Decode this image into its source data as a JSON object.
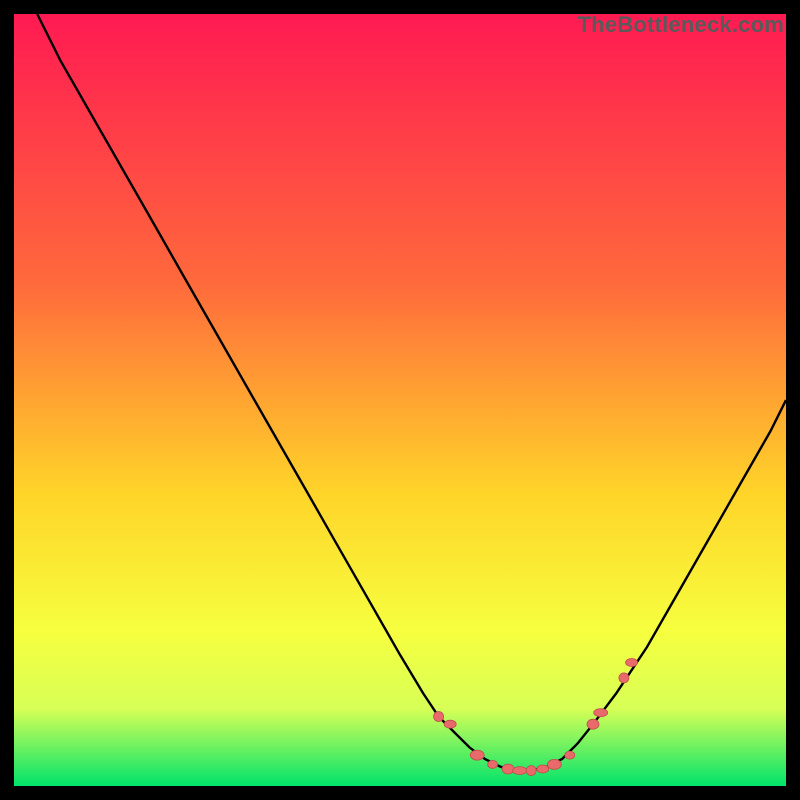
{
  "watermark": "TheBottleneck.com",
  "colors": {
    "frame": "#000000",
    "gradient_top": "#ff1a52",
    "gradient_mid1": "#ff6a3c",
    "gradient_mid2": "#ffd429",
    "gradient_mid3": "#f6ff3f",
    "gradient_bottom_band": "#d7ff56",
    "gradient_bottom": "#00e36b",
    "curve": "#000000",
    "marker_fill": "#e86a6a",
    "marker_stroke": "#c14d4d"
  },
  "chart_data": {
    "type": "line",
    "title": "",
    "xlabel": "",
    "ylabel": "",
    "xlim": [
      0,
      100
    ],
    "ylim": [
      0,
      100
    ],
    "series": [
      {
        "name": "bottleneck-curve",
        "x": [
          3,
          6,
          10,
          14,
          18,
          22,
          26,
          30,
          34,
          38,
          42,
          46,
          50,
          53,
          55,
          57,
          59,
          61,
          63,
          65,
          67,
          69,
          71,
          73,
          75,
          78,
          82,
          86,
          90,
          94,
          98,
          100
        ],
        "y": [
          100,
          94,
          87,
          80,
          73,
          66,
          59,
          52,
          45,
          38,
          31,
          24,
          17,
          12,
          9,
          7,
          5,
          3.5,
          2.5,
          2,
          2,
          2.5,
          3.5,
          5.5,
          8,
          12,
          18,
          25,
          32,
          39,
          46,
          50
        ]
      }
    ],
    "markers": {
      "name": "highlight-points",
      "x": [
        55,
        56.5,
        60,
        62,
        64,
        65.5,
        67,
        68.5,
        70,
        72,
        75,
        76,
        79,
        80
      ],
      "y": [
        9,
        8,
        4,
        2.8,
        2.2,
        2,
        2,
        2.2,
        2.8,
        4,
        8,
        9.5,
        14,
        16
      ]
    }
  }
}
